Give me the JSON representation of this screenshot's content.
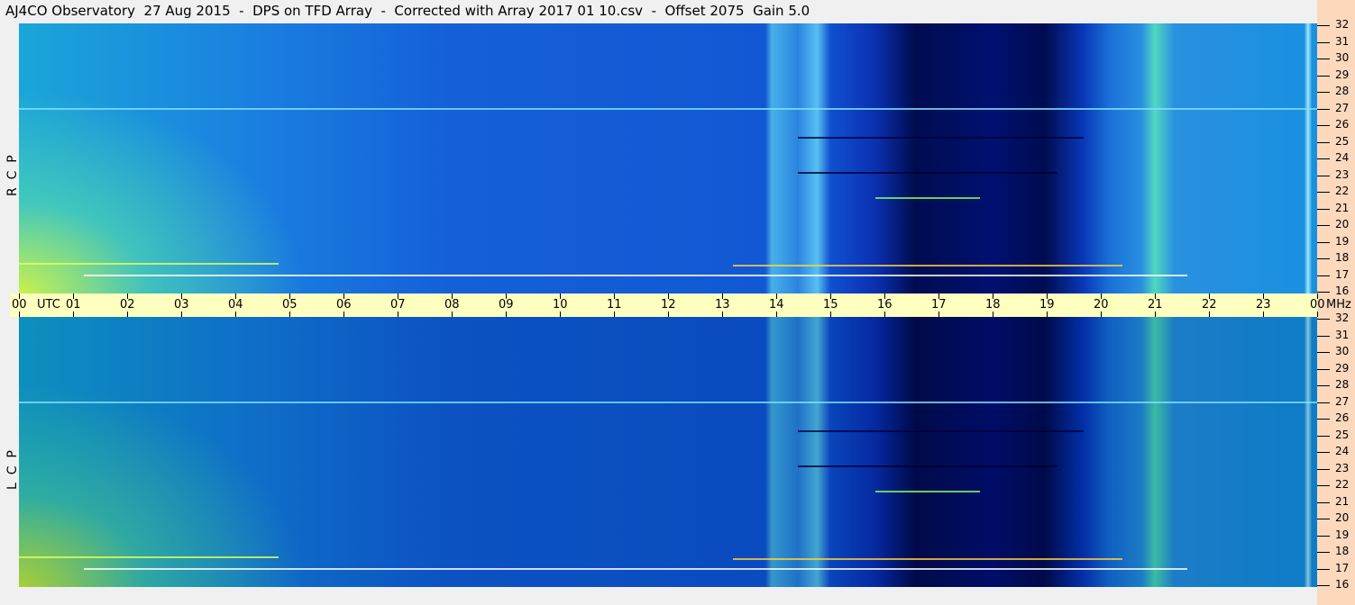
{
  "title": "AJ4CO Observatory  27 Aug 2015  -  DPS on TFD Array  -  Corrected with Array 2017 01 10.csv  -  Offset 2075  Gain 5.0",
  "colors": {
    "timebar": "#ffffc0",
    "axis": "#fcd8bc"
  },
  "chart_data": {
    "type": "heatmap",
    "title": "AJ4CO Observatory  27 Aug 2015  -  DPS on TFD Array",
    "x_ticks": [
      "00",
      "01",
      "02",
      "03",
      "04",
      "05",
      "06",
      "07",
      "08",
      "09",
      "10",
      "11",
      "12",
      "13",
      "14",
      "15",
      "16",
      "17",
      "18",
      "19",
      "20",
      "21",
      "22",
      "23",
      "00"
    ],
    "x_unit": "UTC",
    "y_unit": "MHz",
    "y_ticks": [
      16,
      17,
      18,
      19,
      20,
      21,
      22,
      23,
      24,
      25,
      26,
      27,
      28,
      29,
      30,
      31,
      32
    ],
    "ylim": [
      16,
      32
    ],
    "xlim": [
      0,
      24
    ],
    "panels": [
      {
        "name": "RCP",
        "label": "R  C  P"
      },
      {
        "name": "LCP",
        "label": "L  C  P"
      }
    ]
  }
}
